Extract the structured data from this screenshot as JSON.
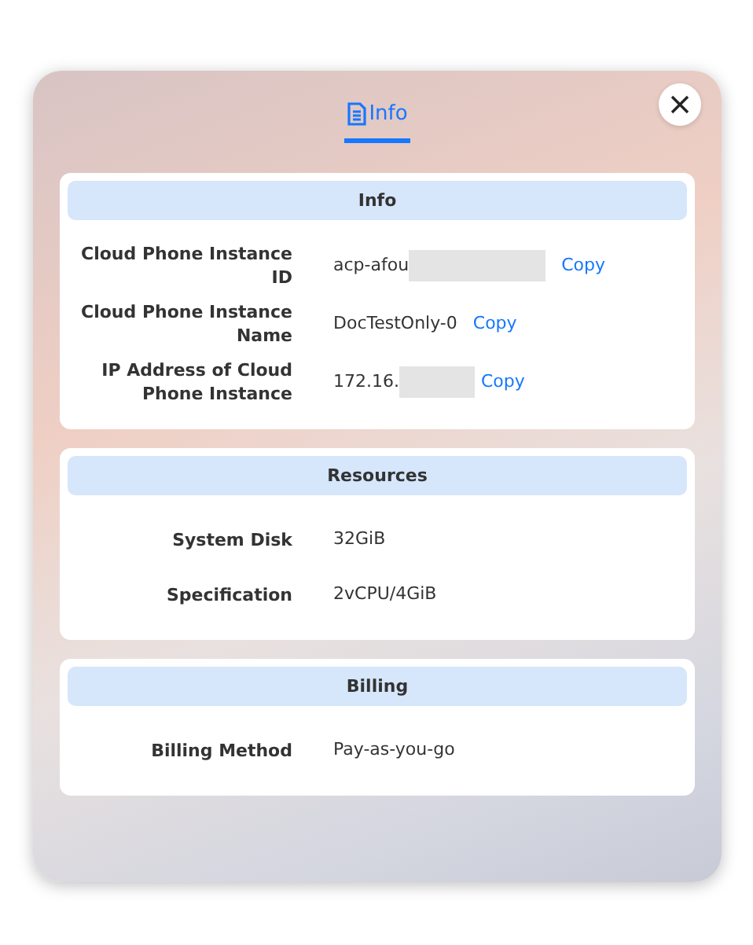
{
  "tabs": [
    {
      "label": "Info",
      "selected": true
    }
  ],
  "sections": [
    {
      "title": "Info",
      "rows": [
        {
          "label": "Cloud Phone Instance ID",
          "value": "acp-afou",
          "redacted": true,
          "action": "Copy"
        },
        {
          "label": "Cloud Phone Instance Name",
          "value": "DocTestOnly-0",
          "redacted": false,
          "action": "Copy"
        },
        {
          "label": "IP Address of Cloud Phone Instance",
          "value": "172.16.",
          "redacted": true,
          "action": "Copy"
        }
      ]
    },
    {
      "title": "Resources",
      "rows": [
        {
          "label": "System Disk",
          "value": "32GiB",
          "redacted": false
        },
        {
          "label": "Specification",
          "value": "2vCPU/4GiB",
          "redacted": false
        }
      ]
    },
    {
      "title": "Billing",
      "rows": [
        {
          "label": "Billing Method",
          "value": "Pay-as-you-go",
          "redacted": false
        }
      ]
    }
  ]
}
